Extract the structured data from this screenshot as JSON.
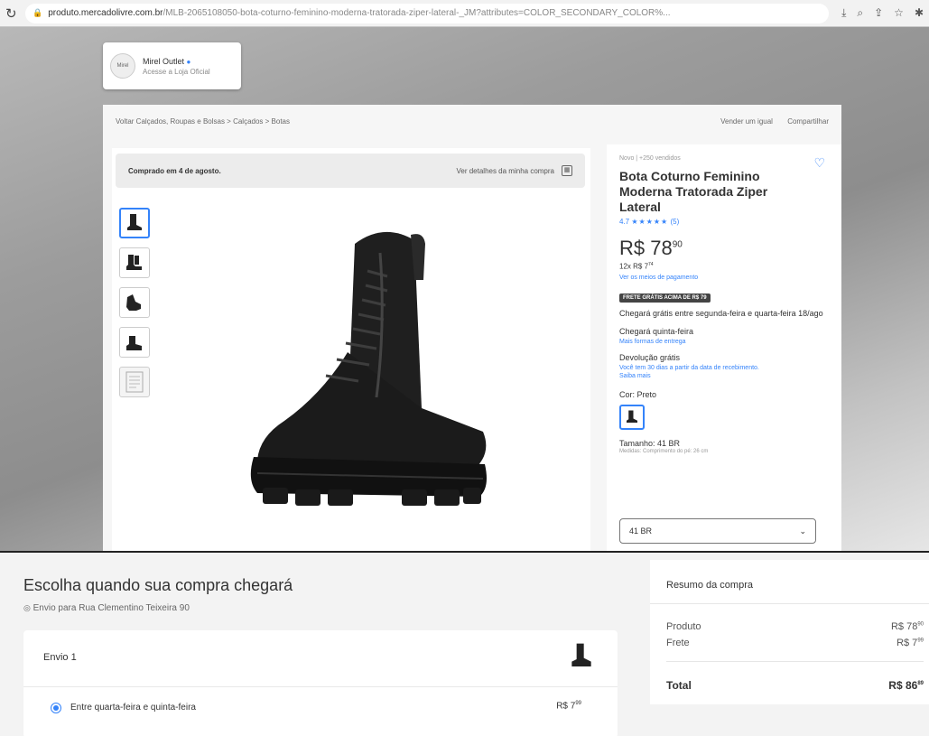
{
  "browser": {
    "url_domain": "produto.mercadolivre.com.br",
    "url_path": "/MLB-2065108050-bota-coturno-feminino-moderna-tratorada-ziper-lateral-_JM?attributes=COLOR_SECONDARY_COLOR%...",
    "reload_icon": "↻",
    "lock_icon": "🔒",
    "actions": [
      "⤓",
      "⌕",
      "⇪",
      "☆",
      "✱"
    ]
  },
  "store": {
    "logo_text": "Mirel",
    "name": "Mirel Outlet",
    "verified_icon": "●",
    "subtitle": "Acesse a Loja Oficial"
  },
  "breadcrumb": {
    "left": "Voltar   Calçados, Roupas e Bolsas > Calçados > Botas",
    "right": [
      "Vender um igual",
      "Compartilhar"
    ]
  },
  "purchase": {
    "title": "Comprado em 4 de agosto.",
    "link": "Ver detalhes da minha compra",
    "calendar_icon": "▦"
  },
  "product": {
    "condition": "Novo  |  +250 vendidos",
    "title": "Bota Coturno Feminino Moderna Tratorada Ziper Lateral",
    "rating_value": "4.7",
    "stars": "★★★★★",
    "rating_count": "(5)",
    "price_main": "R$ 78",
    "price_cents": "90",
    "installments": "12x R$ 7",
    "installments_cents": "74",
    "pay_link": "Ver os meios de pagamento",
    "promo": "FRETE GRÁTIS ACIMA DE R$ 79",
    "ship1": "Chegará grátis entre segunda-feira e quarta-feira 18/ago",
    "ship2": "Chegará quinta-feira",
    "ship2_sub": "Mais formas de entrega",
    "return_title": "Devolução grátis",
    "return_sub": "Você tem 30 dias a partir da data de recebimento.",
    "return_link": "Saiba mais",
    "color_label": "Cor: Preto",
    "size_label": "Tamanho: 41 BR",
    "size_sub": "Medidas: Comprimento do pé: 26 cm",
    "size_value": "41 BR",
    "chevron_icon": "⌄",
    "heart_icon": "♡"
  },
  "checkout": {
    "title": "Escolha quando sua compra chegará",
    "pin_icon": "◎",
    "address": "Envio para Rua Clementino Teixeira 90",
    "shipment_label": "Envio 1",
    "option_label": "Entre quarta-feira e quinta-feira",
    "option_price": "R$ 7",
    "option_price_cents": "99"
  },
  "summary": {
    "title": "Resumo da compra",
    "rows": [
      {
        "label": "Produto",
        "value": "R$ 78",
        "cents": "90"
      },
      {
        "label": "Frete",
        "value": "R$ 7",
        "cents": "99"
      }
    ],
    "total_label": "Total",
    "total_value": "R$ 86",
    "total_cents": "89"
  },
  "colors": {
    "accent": "#3483fa"
  }
}
